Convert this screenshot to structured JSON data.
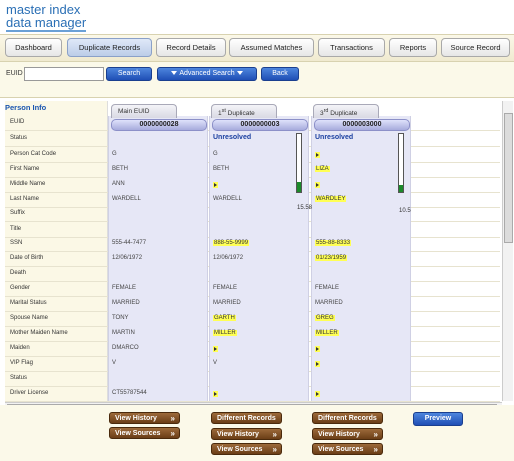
{
  "logo": {
    "line1": "master index",
    "line2": "data manager"
  },
  "nav": {
    "tabs": [
      "Dashboard",
      "Duplicate Records",
      "Record Details",
      "Assumed Matches",
      "Transactions",
      "Reports",
      "Source Record"
    ],
    "active": "Duplicate Records"
  },
  "search": {
    "euid_label": "EUID",
    "euid_value": "",
    "search_label": "Search",
    "advanced_label": "Advanced Search",
    "back_label": "Back"
  },
  "person_info": {
    "title": "Person Info",
    "fields": [
      "EUID",
      "Status",
      "Person Cat Code",
      "First Name",
      "Middle Name",
      "Last Name",
      "Suffix",
      "Title",
      "SSN",
      "Date of Birth",
      "Death",
      "Gender",
      "Marital Status",
      "Spouse Name",
      "Mother Maiden Name",
      "Maiden",
      "VIP Flag",
      "Status",
      "Driver License"
    ]
  },
  "columns": [
    {
      "tab": "Main EUID",
      "euid": "0000000028",
      "status": "",
      "person_cat_code": "G",
      "first_name": "BETH",
      "middle_name": "ANN",
      "last_name": "WARDELL",
      "ssn": "555-44-7477",
      "dob": "12/06/1972",
      "gender": "FEMALE",
      "marital_status": "MARRIED",
      "spouse_name": "TONY",
      "mother_maiden_name": "MARTIN",
      "maiden": "DMARCO",
      "vip_flag": "V",
      "driver_license": "CT55787544"
    },
    {
      "tab_num": "1",
      "tab_sup": "st",
      "tab_rest": " Duplicate",
      "euid": "0000000003",
      "status": "Unresolved",
      "person_cat_code": "G",
      "first_name": "BETH",
      "last_name": "WARDELL",
      "ssn": "888-55-9999",
      "dob": "12/06/1972",
      "gender": "FEMALE",
      "marital_status": "MARRIED",
      "spouse_name": "GARTH",
      "mother_maiden_name": "MILLER",
      "vip_flag": "V",
      "score": "15.58",
      "score_fill": 0.18
    },
    {
      "tab_num": "3",
      "tab_sup": "rd",
      "tab_rest": " Duplicate",
      "euid": "0000003000",
      "status": "Unresolved",
      "first_name": "LIZA",
      "last_name": "WARDLEY",
      "ssn": "555-88-8333",
      "dob": "01/23/1959",
      "gender": "FEMALE",
      "marital_status": "MARRIED",
      "spouse_name": "GREG",
      "mother_maiden_name": "MILLER",
      "score": "10.5",
      "score_fill": 0.12
    }
  ],
  "bottom": {
    "view_history": "View History",
    "view_sources": "View Sources",
    "different_records": "Different Records",
    "preview": "Preview"
  },
  "colors": {
    "brand_blue": "#2a6fb5",
    "highlight": "#ffff55",
    "score_green": "#1c8a2a",
    "button_brown": "#6b3e16"
  }
}
